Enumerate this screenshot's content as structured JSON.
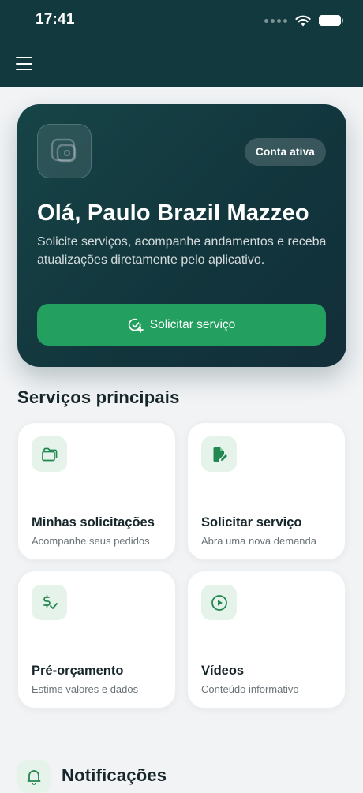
{
  "status_bar": {
    "time": "17:41"
  },
  "header": {
    "menu_icon": "hamburger-menu-icon"
  },
  "hero": {
    "badge": "Conta ativa",
    "greeting": "Olá, Paulo Brazil Mazzeo",
    "subtitle": "Solicite serviços, acompanhe andamentos e receba atualizações diretamente pelo aplicativo.",
    "cta_label": "Solicitar serviço",
    "cta_icon": "check-plus-icon"
  },
  "services": {
    "title": "Serviços principais",
    "items": [
      {
        "title": "Minhas solicitações",
        "subtitle": "Acompanhe seus pedidos",
        "icon": "folder-icon"
      },
      {
        "title": "Solicitar serviço",
        "subtitle": "Abra uma nova demanda",
        "icon": "document-edit-icon"
      },
      {
        "title": "Pré-orçamento",
        "subtitle": "Estime valores e dados",
        "icon": "dollar-check-icon"
      },
      {
        "title": "Vídeos",
        "subtitle": "Conteúdo informativo",
        "icon": "play-circle-icon"
      }
    ]
  },
  "notifications": {
    "title": "Notificações",
    "icon": "bell-icon"
  },
  "colors": {
    "header_bg": "#123a3e",
    "accent_green": "#23a05f",
    "icon_tile_bg": "#e5f3ea",
    "page_bg": "#f1f3f5"
  }
}
